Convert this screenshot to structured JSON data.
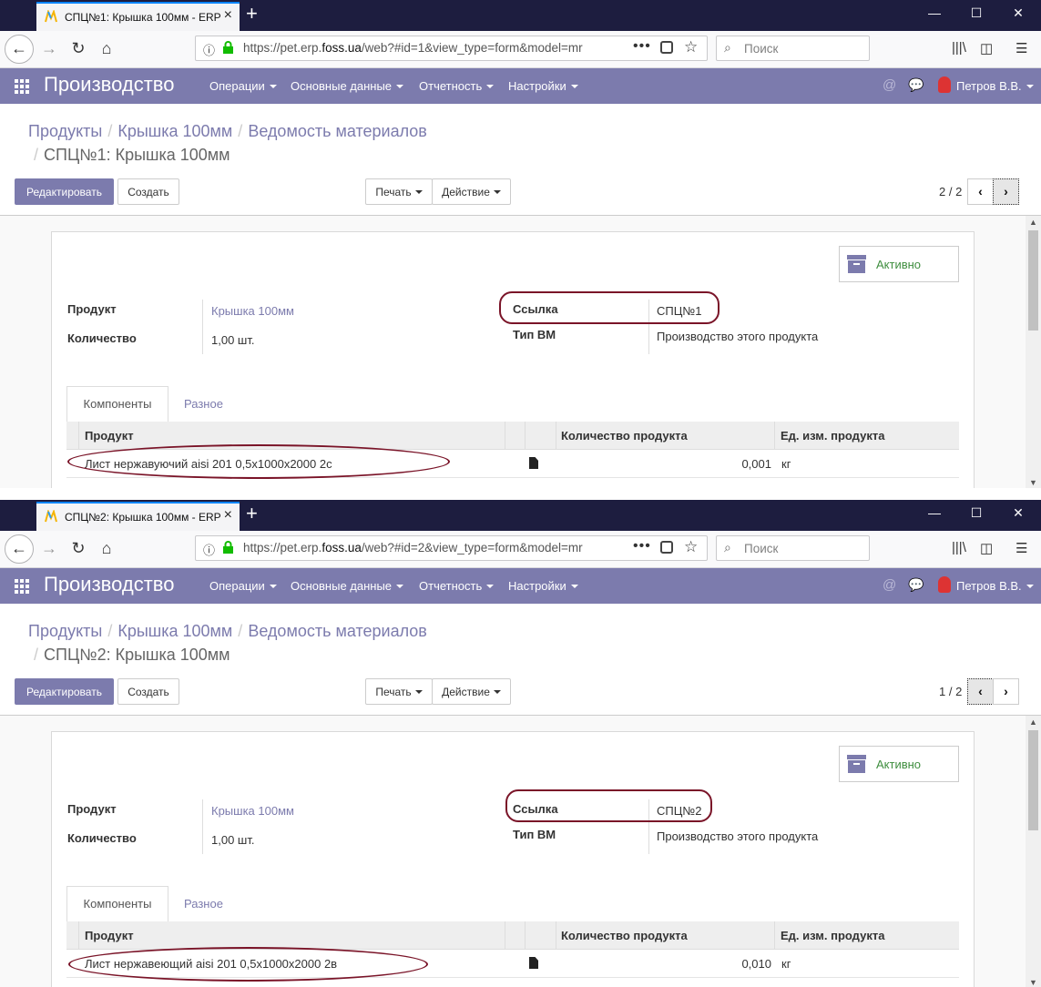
{
  "windows": [
    {
      "tab_title": "СПЦ№1: Крышка 100мм - ERP",
      "url_prefix": "https://pet.erp.",
      "url_domain": "foss.ua",
      "url_suffix": "/web?#id=1&view_type=form&model=mr",
      "search_placeholder": "Поиск",
      "app_title": "Производство",
      "menu": [
        "Операции",
        "Основные данные",
        "Отчетность",
        "Настройки"
      ],
      "user": "Петров В.В.",
      "breadcrumb": [
        "Продукты",
        "Крышка 100мм",
        "Ведомость материалов"
      ],
      "record_title": "СПЦ№1: Крышка 100мм",
      "buttons": {
        "edit": "Редактировать",
        "create": "Создать",
        "print": "Печать",
        "action": "Действие"
      },
      "pager": "2 / 2",
      "status": "Активно",
      "fields": {
        "product_label": "Продукт",
        "product_value": "Крышка 100мм",
        "qty_label": "Количество",
        "qty_value": "1,00 шт.",
        "ref_label": "Ссылка",
        "ref_value": "СПЦ№1",
        "type_label": "Тип BM",
        "type_value": "Производство этого продукта"
      },
      "tabs": [
        "Компоненты",
        "Разное"
      ],
      "table": {
        "headers": [
          "Продукт",
          "Количество продукта",
          "Ед. изм. продукта"
        ],
        "rows": [
          {
            "product": "Лист нержавуючий aisi 201 0,5x1000x2000 2с",
            "qty": "0,001",
            "uom": "кг"
          }
        ]
      }
    },
    {
      "tab_title": "СПЦ№2: Крышка 100мм - ERP",
      "url_prefix": "https://pet.erp.",
      "url_domain": "foss.ua",
      "url_suffix": "/web?#id=2&view_type=form&model=mr",
      "search_placeholder": "Поиск",
      "app_title": "Производство",
      "menu": [
        "Операции",
        "Основные данные",
        "Отчетность",
        "Настройки"
      ],
      "user": "Петров В.В.",
      "breadcrumb": [
        "Продукты",
        "Крышка 100мм",
        "Ведомость материалов"
      ],
      "record_title": "СПЦ№2: Крышка 100мм",
      "buttons": {
        "edit": "Редактировать",
        "create": "Создать",
        "print": "Печать",
        "action": "Действие"
      },
      "pager": "1 / 2",
      "status": "Активно",
      "fields": {
        "product_label": "Продукт",
        "product_value": "Крышка 100мм",
        "qty_label": "Количество",
        "qty_value": "1,00 шт.",
        "ref_label": "Ссылка",
        "ref_value": "СПЦ№2",
        "type_label": "Тип BM",
        "type_value": "Производство этого продукта"
      },
      "tabs": [
        "Компоненты",
        "Разное"
      ],
      "table": {
        "headers": [
          "Продукт",
          "Количество продукта",
          "Ед. изм. продукта"
        ],
        "rows": [
          {
            "product": "Лист нержавеющий aisi 201 0,5x1000x2000 2в",
            "qty": "0,010",
            "uom": "кг"
          }
        ]
      }
    }
  ],
  "icons": {
    "back": "arrow-left-icon",
    "forward": "arrow-right-icon",
    "reload": "reload-icon",
    "home": "home-icon",
    "info": "info-icon",
    "lock": "lock-icon",
    "page_actions": "more-icon",
    "pocket": "pocket-icon",
    "bookmark": "star-icon",
    "search": "search-icon",
    "library": "library-icon",
    "sidebar": "sidebar-icon",
    "menu": "hamburger-icon",
    "apps": "apps-grid-icon",
    "mention": "at-icon",
    "chat": "chat-icon",
    "archive": "archive-icon",
    "file": "file-icon"
  },
  "colors": {
    "odoo_purple": "#7c7bad",
    "titlebar": "#1d1d3f",
    "active_green": "#3f8e3f",
    "highlight_oval": "#7a1428"
  }
}
